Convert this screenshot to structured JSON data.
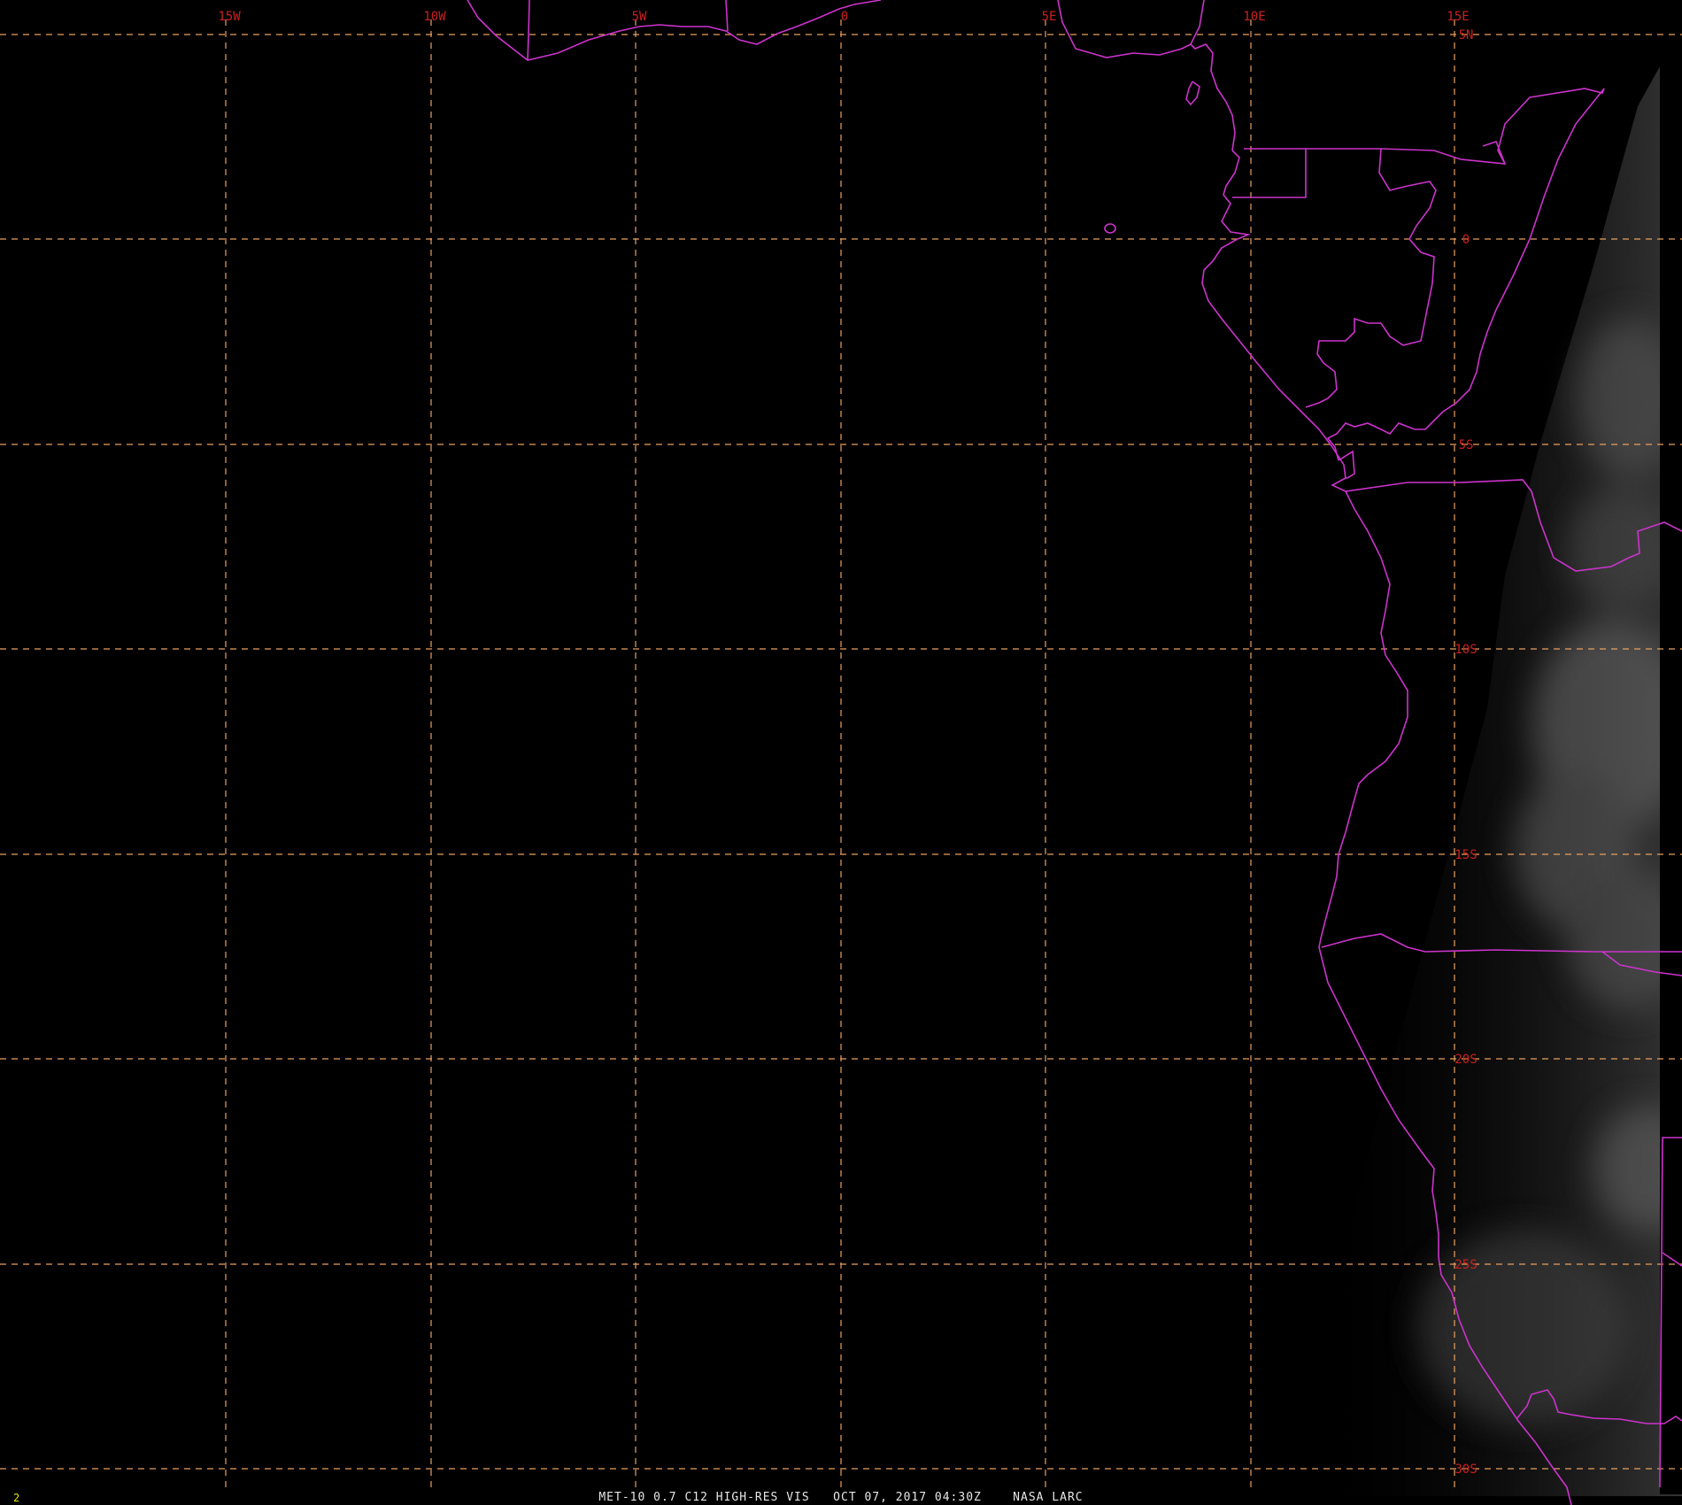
{
  "image": {
    "caption": "MET-10 0.7 C12 HIGH-RES VIS   OCT 07, 2017 04:30Z    NASA LARC",
    "frame_number": "2"
  },
  "grid": {
    "longitude_labels": [
      "15W",
      "10W",
      "5W",
      "0",
      "5E",
      "10E",
      "15E"
    ],
    "latitude_labels": [
      "5N",
      "0",
      "5S",
      "10S",
      "15S",
      "20S",
      "25S",
      "30S"
    ],
    "line_color": "#e8a060",
    "label_color": "#cc2020"
  },
  "map": {
    "boundary_color": "#cc33cc",
    "background_color": "#000000"
  }
}
